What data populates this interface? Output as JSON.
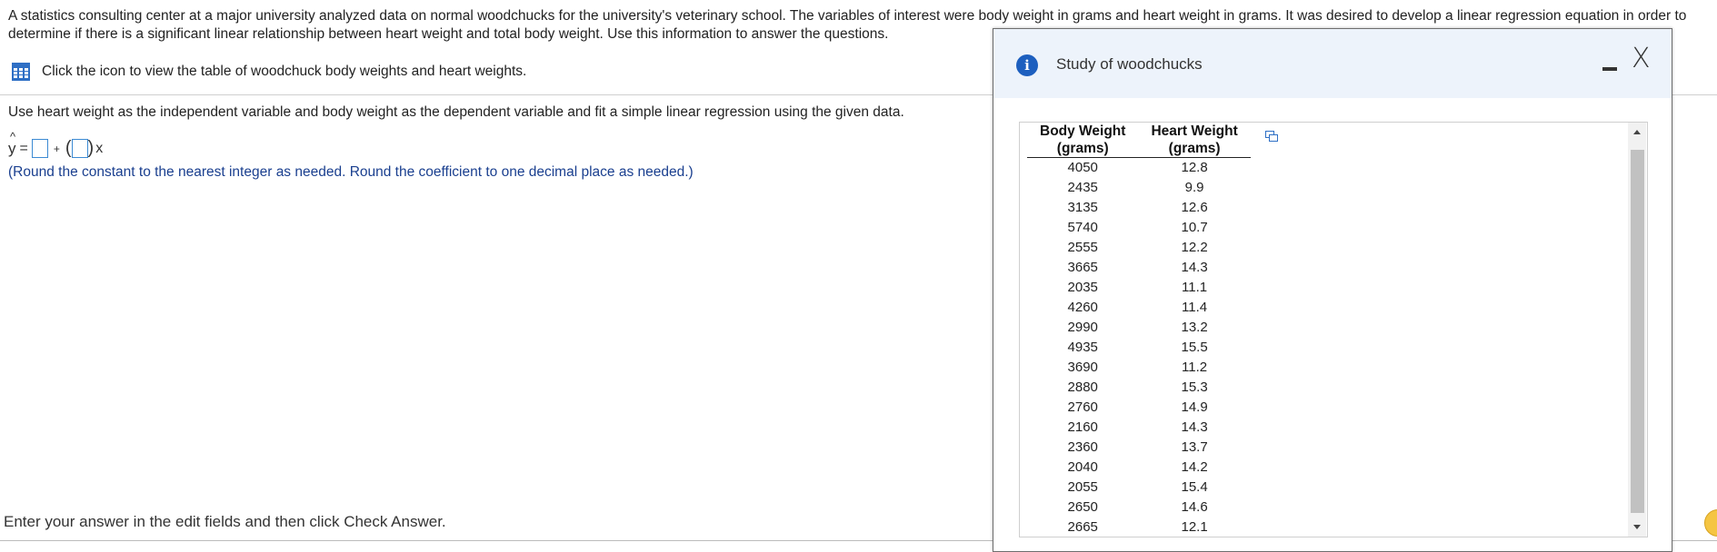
{
  "question": {
    "intro": "A statistics consulting center at a major university analyzed data on normal woodchucks for the university's veterinary school. The variables of interest were body weight in grams and heart weight in grams. It was desired to develop a linear regression equation in order to determine if there is a significant linear relationship between heart weight and total body weight. Use this information to answer the questions.",
    "table_link": "Click the icon to view the table of woodchuck body weights and heart weights.",
    "instruction": "Use heart weight as the independent variable and body weight as the dependent variable and fit a simple linear regression using the given data.",
    "equation": {
      "lhs": "y",
      "equals": "=",
      "plus": "+",
      "x": "x"
    },
    "round_note": "(Round the constant to the nearest integer as needed. Round the coefficient to one decimal place as needed.)",
    "footer": "Enter your answer in the edit fields and then click Check Answer."
  },
  "dialog": {
    "title": "Study of woodchucks",
    "close_label": "X",
    "table": {
      "headers": [
        [
          "Body Weight",
          "(grams)"
        ],
        [
          "Heart Weight",
          "(grams)"
        ]
      ],
      "rows": [
        [
          "4050",
          "12.8"
        ],
        [
          "2435",
          "9.9"
        ],
        [
          "3135",
          "12.6"
        ],
        [
          "5740",
          "10.7"
        ],
        [
          "2555",
          "12.2"
        ],
        [
          "3665",
          "14.3"
        ],
        [
          "2035",
          "11.1"
        ],
        [
          "4260",
          "11.4"
        ],
        [
          "2990",
          "13.2"
        ],
        [
          "4935",
          "15.5"
        ],
        [
          "3690",
          "11.2"
        ],
        [
          "2880",
          "15.3"
        ],
        [
          "2760",
          "14.9"
        ],
        [
          "2160",
          "14.3"
        ],
        [
          "2360",
          "13.7"
        ],
        [
          "2040",
          "14.2"
        ],
        [
          "2055",
          "15.4"
        ],
        [
          "2650",
          "14.6"
        ],
        [
          "2665",
          "12.1"
        ]
      ]
    }
  },
  "colors": {
    "accent": "#1d5fbf",
    "note_text": "#1a3f8f",
    "dialog_header": "#edf3fb",
    "input_border": "#3c8ad3"
  },
  "icons": [
    "grid-table-icon",
    "info-icon",
    "minimize-icon",
    "close-icon",
    "copy-icon",
    "feedback-icon"
  ]
}
